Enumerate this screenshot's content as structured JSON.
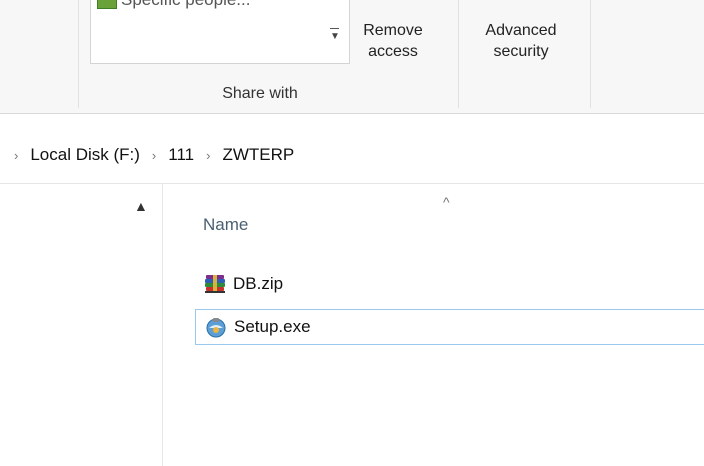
{
  "ribbon": {
    "share_people_label": "Specific people...",
    "remove_access": [
      "Remove",
      "access"
    ],
    "advanced_security": [
      "Advanced",
      "security"
    ],
    "group_label": "Share with"
  },
  "address": {
    "crumbs": [
      "Local Disk (F:)",
      "111",
      "ZWTERP"
    ]
  },
  "file_list": {
    "column_name": "Name",
    "files": [
      {
        "name": "DB.zip",
        "icon": "winrar-archive-icon",
        "selected": false
      },
      {
        "name": "Setup.exe",
        "icon": "setup-exe-icon",
        "selected": true
      }
    ]
  },
  "colors": {
    "selection_border": "#99c9ef",
    "header_text": "#4a6072"
  }
}
